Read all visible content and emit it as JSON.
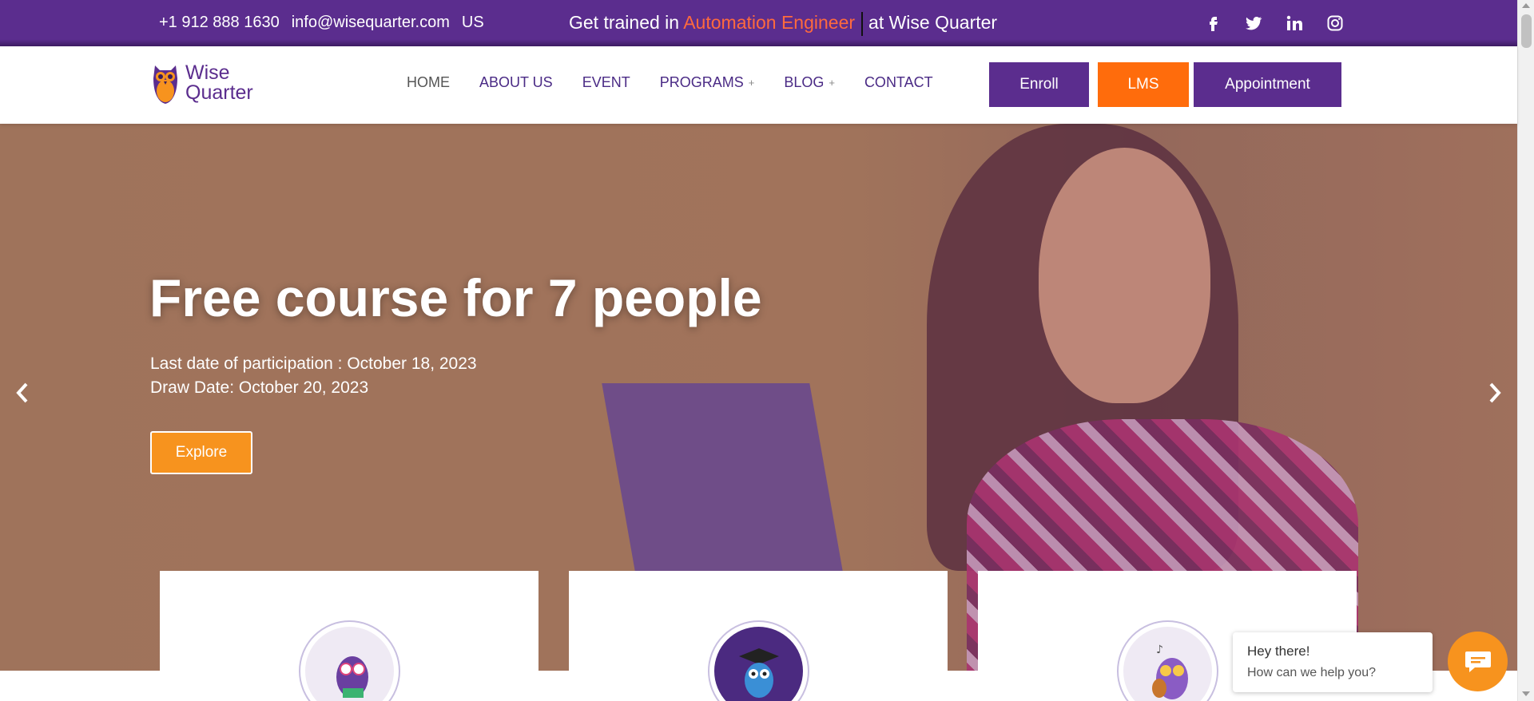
{
  "topbar": {
    "phone": "+1 912 888 1630",
    "email": "info@wisequarter.com",
    "region": "US",
    "promo_prefix": "Get trained in",
    "promo_highlight": "Automation Engineer",
    "promo_suffix": "at Wise Quarter",
    "social_icons": [
      "facebook-icon",
      "twitter-icon",
      "linkedin-icon",
      "instagram-icon"
    ]
  },
  "header": {
    "logo_line1": "Wise",
    "logo_line2": "Quarter",
    "nav": [
      {
        "label": "HOME"
      },
      {
        "label": "ABOUT US"
      },
      {
        "label": "EVENT"
      },
      {
        "label": "PROGRAMS",
        "expand": "+"
      },
      {
        "label": "BLOG",
        "expand": "+"
      },
      {
        "label": "CONTACT"
      }
    ],
    "buttons": {
      "enroll": "Enroll",
      "lms": "LMS",
      "appointment": "Appointment"
    }
  },
  "hero": {
    "title": "Free course for 7 people",
    "line1": "Last date of participation : October 18, 2023",
    "line2": "Draw Date: October 20, 2023",
    "cta": "Explore",
    "prev_icon": "chevron-left-icon",
    "next_icon": "chevron-right-icon"
  },
  "chat": {
    "greeting": "Hey there!",
    "prompt": "How can we help you?",
    "icon": "chat-icon"
  },
  "colors": {
    "brand_purple": "#5b2d8e",
    "accent_orange": "#ff6c0c",
    "promo_orange": "#ff6a3d",
    "explore_orange": "#f7931e"
  }
}
